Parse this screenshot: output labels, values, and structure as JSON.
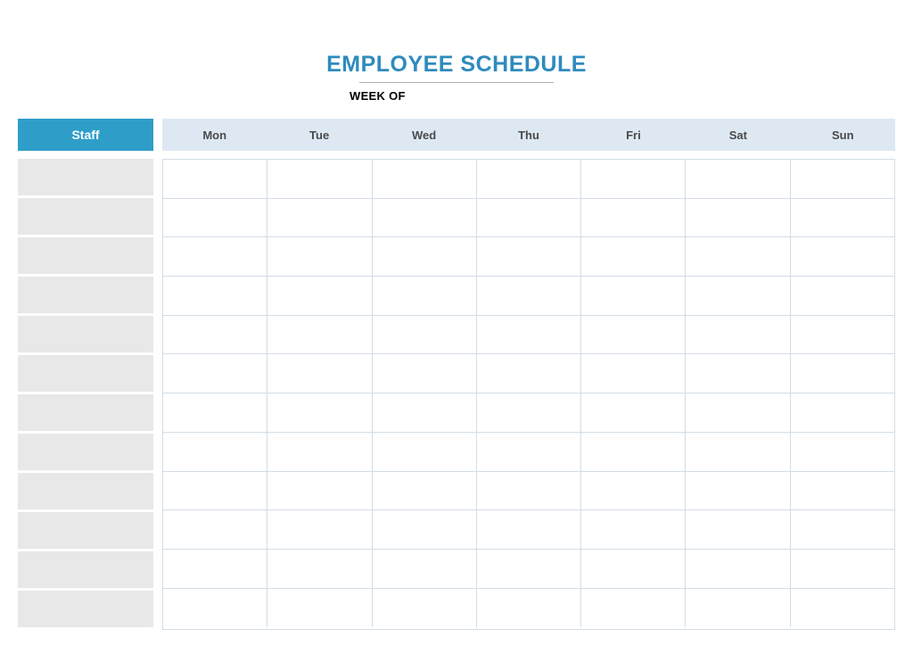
{
  "title": "EMPLOYEE SCHEDULE",
  "week_of_label": "WEEK OF",
  "staff_header": "Staff",
  "days": [
    "Mon",
    "Tue",
    "Wed",
    "Thu",
    "Fri",
    "Sat",
    "Sun"
  ],
  "rows": [
    {
      "staff": "",
      "cells": [
        "",
        "",
        "",
        "",
        "",
        "",
        ""
      ]
    },
    {
      "staff": "",
      "cells": [
        "",
        "",
        "",
        "",
        "",
        "",
        ""
      ]
    },
    {
      "staff": "",
      "cells": [
        "",
        "",
        "",
        "",
        "",
        "",
        ""
      ]
    },
    {
      "staff": "",
      "cells": [
        "",
        "",
        "",
        "",
        "",
        "",
        ""
      ]
    },
    {
      "staff": "",
      "cells": [
        "",
        "",
        "",
        "",
        "",
        "",
        ""
      ]
    },
    {
      "staff": "",
      "cells": [
        "",
        "",
        "",
        "",
        "",
        "",
        ""
      ]
    },
    {
      "staff": "",
      "cells": [
        "",
        "",
        "",
        "",
        "",
        "",
        ""
      ]
    },
    {
      "staff": "",
      "cells": [
        "",
        "",
        "",
        "",
        "",
        "",
        ""
      ]
    },
    {
      "staff": "",
      "cells": [
        "",
        "",
        "",
        "",
        "",
        "",
        ""
      ]
    },
    {
      "staff": "",
      "cells": [
        "",
        "",
        "",
        "",
        "",
        "",
        ""
      ]
    },
    {
      "staff": "",
      "cells": [
        "",
        "",
        "",
        "",
        "",
        "",
        ""
      ]
    },
    {
      "staff": "",
      "cells": [
        "",
        "",
        "",
        "",
        "",
        "",
        ""
      ]
    }
  ]
}
